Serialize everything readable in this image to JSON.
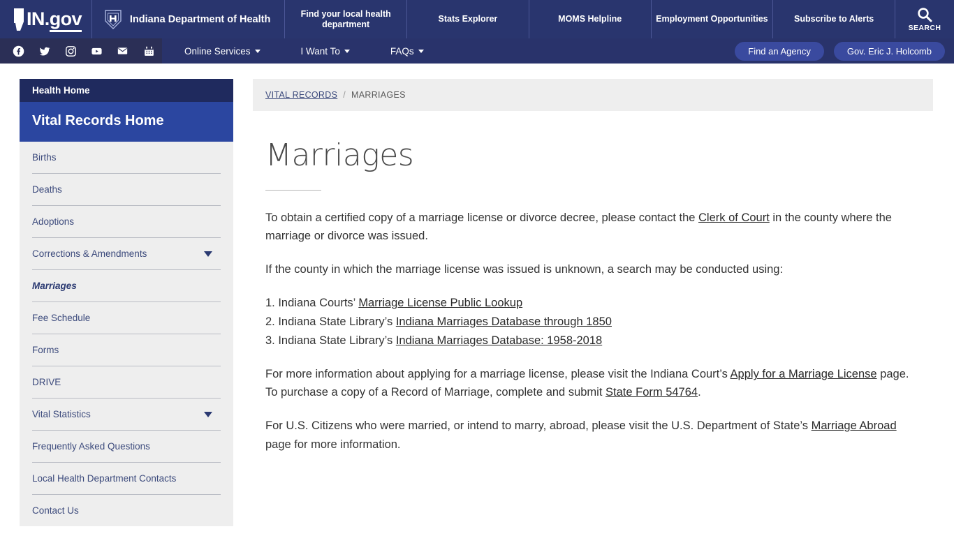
{
  "header": {
    "logo_text_in": "IN.",
    "logo_text_gov": "gov",
    "agency_name": "Indiana Department of Health",
    "shield_icon": "shield-h-icon",
    "nav_items": [
      {
        "label": "Find your local health department"
      },
      {
        "label": "Stats Explorer"
      },
      {
        "label": "MOMS Helpline"
      },
      {
        "label": "Employment Opportunities"
      },
      {
        "label": "Subscribe to Alerts"
      }
    ],
    "search": {
      "icon": "search-icon",
      "label": "SEARCH"
    }
  },
  "subnav": {
    "social": [
      {
        "name": "facebook-icon",
        "glyph": "f"
      },
      {
        "name": "twitter-icon",
        "glyph": "t"
      },
      {
        "name": "instagram-icon",
        "glyph": "i"
      },
      {
        "name": "youtube-icon",
        "glyph": "y"
      },
      {
        "name": "email-icon",
        "glyph": "e"
      },
      {
        "name": "calendar-icon",
        "glyph": "c"
      }
    ],
    "links": [
      {
        "label": "Online Services",
        "caret": true
      },
      {
        "label": "I Want To",
        "caret": true
      },
      {
        "label": "FAQs",
        "caret": true
      }
    ],
    "buttons": [
      {
        "label": "Find an Agency"
      },
      {
        "label": "Gov. Eric J. Holcomb"
      }
    ]
  },
  "sidebar": {
    "health_home": "Health Home",
    "section_title": "Vital Records Home",
    "items": [
      {
        "label": "Births",
        "caret": false,
        "active": false
      },
      {
        "label": "Deaths",
        "caret": false,
        "active": false
      },
      {
        "label": "Adoptions",
        "caret": false,
        "active": false
      },
      {
        "label": "Corrections & Amendments",
        "caret": true,
        "active": false
      },
      {
        "label": "Marriages",
        "caret": false,
        "active": true
      },
      {
        "label": "Fee Schedule",
        "caret": false,
        "active": false
      },
      {
        "label": "Forms",
        "caret": false,
        "active": false
      },
      {
        "label": "DRIVE",
        "caret": false,
        "active": false
      },
      {
        "label": "Vital Statistics",
        "caret": true,
        "active": false
      },
      {
        "label": "Frequently Asked Questions",
        "caret": false,
        "active": false
      },
      {
        "label": "Local Health Department Contacts",
        "caret": false,
        "active": false
      },
      {
        "label": "Contact Us",
        "caret": false,
        "active": false
      }
    ]
  },
  "breadcrumb": {
    "parent": "VITAL RECORDS",
    "separator": "/",
    "current": "MARRIAGES"
  },
  "main": {
    "title": "Marriages",
    "para1_a": "To obtain a certified copy of a marriage license or divorce decree, please contact the ",
    "para1_link": "Clerk of Court",
    "para1_b": " in the county where the marriage or divorce was issued.",
    "para2": "If the county in which the marriage license was issued is unknown, a search may be conducted using:",
    "list": [
      {
        "num": "1.",
        "prefix": " Indiana Courts’ ",
        "link": "Marriage License Public Lookup",
        "suffix": ""
      },
      {
        "num": "2.",
        "prefix": " Indiana State Library’s ",
        "link": "Indiana Marriages Database through 1850",
        "suffix": ""
      },
      {
        "num": "3.",
        "prefix": " Indiana State Library’s ",
        "link": "Indiana Marriages Database: 1958-2018",
        "suffix": ""
      }
    ],
    "para3_a": "For more information about applying for a marriage license, please visit the Indiana Court’s ",
    "para3_link1": "Apply for a Marriage License",
    "para3_b": " page. To purchase a copy of a Record of Marriage, complete and submit ",
    "para3_link2": "State Form 54764",
    "para3_c": ".",
    "para4_a": "For U.S. Citizens who were married, or intend to marry, abroad, please visit the U.S. Department of State’s ",
    "para4_link": "Marriage Abroad",
    "para4_b": " page for more information."
  },
  "colors": {
    "header_blue": "#29356e",
    "subnav_blue": "#29336b",
    "social_navy": "#2b2f56",
    "sidebar_active_blue": "#2b46a0",
    "sidebar_dark": "#1f2a5e",
    "pill_blue": "#3a4a9f",
    "panel_gray": "#eeeeee"
  }
}
